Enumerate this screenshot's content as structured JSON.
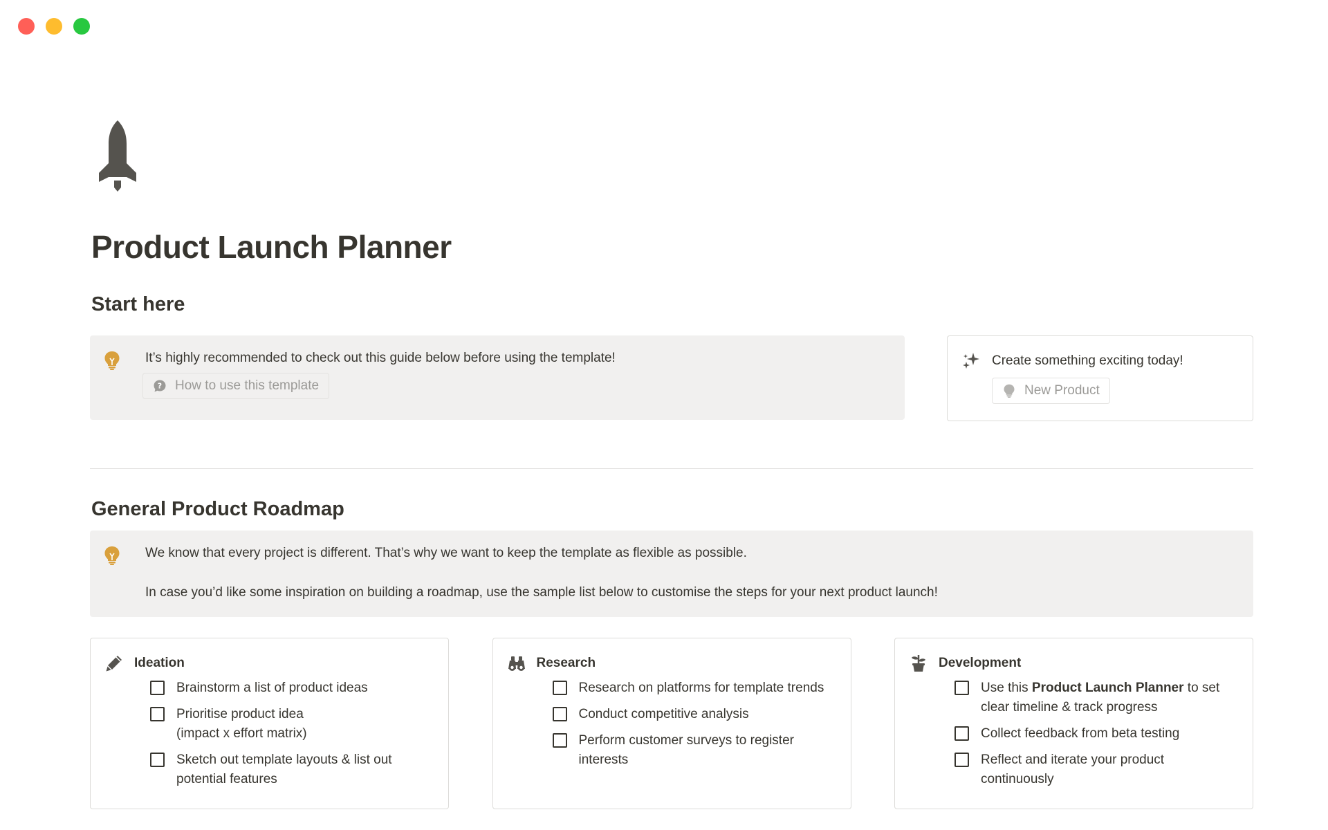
{
  "window": {
    "controls": [
      "close",
      "minimize",
      "zoom"
    ]
  },
  "page": {
    "icon": "rocket-icon",
    "title": "Product Launch Planner"
  },
  "start": {
    "heading": "Start here",
    "callout": {
      "icon": "lightbulb-icon",
      "text": "It’s highly recommended to check out this guide below before using the template!",
      "link_icon": "speech-bubble-icon",
      "link_label": "How to use this template"
    },
    "side_card": {
      "icon": "sparkles-icon",
      "text": "Create something exciting today!",
      "button_icon": "lightbulb-icon",
      "button_label": "New Product"
    }
  },
  "roadmap": {
    "heading": "General Product Roadmap",
    "callout": {
      "icon": "lightbulb-icon",
      "line1": "We know that every project is different. That’s why we want to keep the template as flexible as possible.",
      "line2": "In case you’d like some inspiration on building a roadmap, use the sample list below to customise the steps for your next product launch!"
    },
    "columns": [
      {
        "icon": "pencil-icon",
        "title": "Ideation",
        "items": [
          {
            "text": "Brainstorm a list of product ideas",
            "checked": false
          },
          {
            "text": "Prioritise product idea\n(impact x effort matrix)",
            "checked": false
          },
          {
            "text": "Sketch out template layouts & list out potential features",
            "checked": false
          }
        ]
      },
      {
        "icon": "binoculars-icon",
        "title": "Research",
        "items": [
          {
            "text": "Research on platforms for template trends",
            "checked": false
          },
          {
            "text": "Conduct competitive analysis",
            "checked": false
          },
          {
            "text": "Perform customer surveys to register interests",
            "checked": false
          }
        ]
      },
      {
        "icon": "plant-icon",
        "title": "Development",
        "items": [
          {
            "prefix": "Use this ",
            "bold": "Product Launch Planner",
            "suffix": " to set clear timeline & track progress",
            "checked": false
          },
          {
            "text": "Collect feedback from beta testing",
            "checked": false
          },
          {
            "text": "Reflect and iterate your product continuously",
            "checked": false
          }
        ]
      }
    ]
  },
  "colors": {
    "text": "#37352f",
    "callout_bg": "#f1f0ef",
    "muted": "#9b9a97",
    "icon_gold": "#d9a03c",
    "icon_dark": "#55534e"
  }
}
